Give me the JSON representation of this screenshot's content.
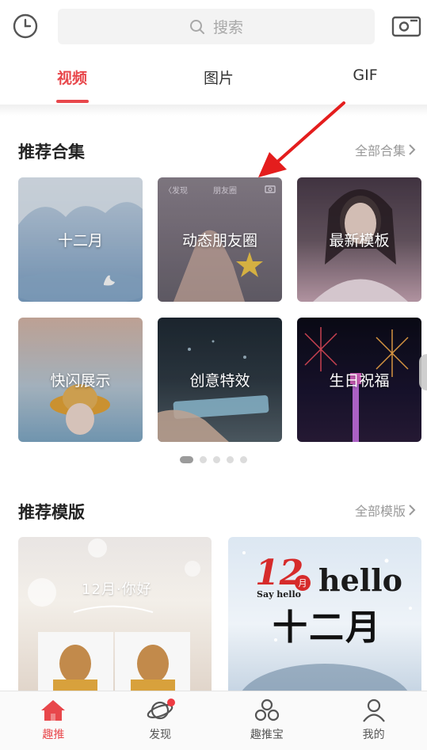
{
  "search": {
    "placeholder": "搜索"
  },
  "tabs": [
    {
      "label": "视频",
      "active": true
    },
    {
      "label": "图片",
      "active": false
    },
    {
      "label": "GIF",
      "active": false
    }
  ],
  "collections": {
    "title": "推荐合集",
    "more_label": "全部合集",
    "items": [
      {
        "label": "十二月"
      },
      {
        "label": "动态朋友圈"
      },
      {
        "label": "最新模板"
      },
      {
        "label": "快闪展示"
      },
      {
        "label": "创意特效"
      },
      {
        "label": "生日祝福"
      }
    ],
    "page_count": 5,
    "active_page": 1
  },
  "templates": {
    "title": "推荐模版",
    "more_label": "全部模版",
    "items": [
      {
        "caption": "12月·你好"
      },
      {
        "caption_big": "12",
        "caption_small": "月",
        "caption_hello": "hello",
        "caption_say": "Say hello",
        "caption_month": "十二月"
      }
    ]
  },
  "card_overlay": {
    "back": "〈发现",
    "title": "朋友圈"
  },
  "bottom_nav": [
    {
      "label": "趣推",
      "icon": "home-icon",
      "active": true
    },
    {
      "label": "发现",
      "icon": "planet-icon",
      "active": false,
      "badge": true
    },
    {
      "label": "趣推宝",
      "icon": "cluster-icon",
      "active": false
    },
    {
      "label": "我的",
      "icon": "user-icon",
      "active": false
    }
  ],
  "colors": {
    "accent": "#e8474b",
    "annotation_arrow": "#e41d1d"
  }
}
